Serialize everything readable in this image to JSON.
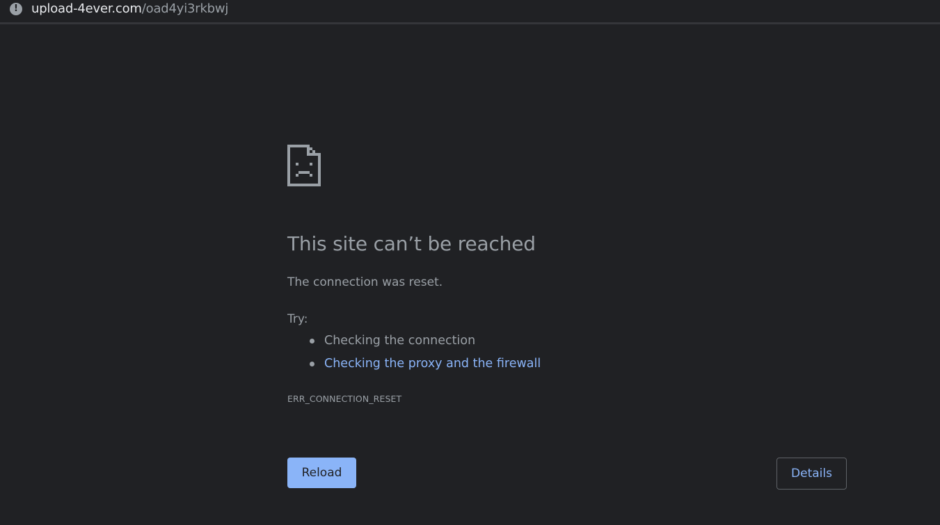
{
  "address_bar": {
    "host": "upload-4ever.com",
    "path": "/oad4yi3rkbwj",
    "info_icon": "info-icon"
  },
  "error_page": {
    "icon": "sad-page-icon",
    "title": "This site can’t be reached",
    "message": "The connection was reset.",
    "try_label": "Try:",
    "suggestions": [
      {
        "text": "Checking the connection",
        "is_link": false
      },
      {
        "text": "Checking the proxy and the firewall",
        "is_link": true
      }
    ],
    "error_code": "ERR_CONNECTION_RESET",
    "reload_label": "Reload",
    "details_label": "Details"
  },
  "colors": {
    "background": "#202124",
    "text": "#9aa0a6",
    "link": "#8ab4f8",
    "reload_bg": "#8ab4f8"
  }
}
